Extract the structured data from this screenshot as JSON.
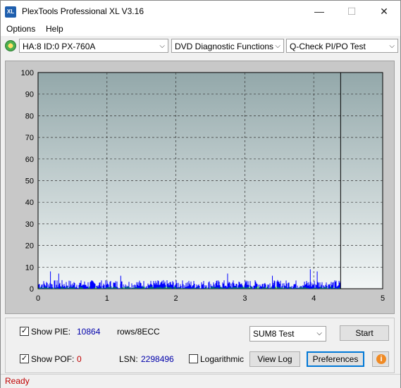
{
  "window": {
    "title": "PlexTools Professional XL V3.16",
    "icon_label": "XL"
  },
  "controls_window": {
    "minimize": "—",
    "maximize": "☐",
    "close": "✕"
  },
  "menu": {
    "items": [
      {
        "label": "Options"
      },
      {
        "label": "Help"
      }
    ]
  },
  "toolbar": {
    "drive": "HA:8 ID:0  PX-760A",
    "function": "DVD Diagnostic Functions",
    "test": "Q-Check PI/PO Test"
  },
  "chart_data": {
    "type": "bar",
    "title": "",
    "xlabel": "",
    "ylabel": "",
    "xlim": [
      0,
      5
    ],
    "ylim": [
      0,
      100
    ],
    "x_ticks": [
      "0",
      "1",
      "2",
      "3",
      "4",
      "5"
    ],
    "y_ticks": [
      "0",
      "10",
      "20",
      "30",
      "40",
      "50",
      "60",
      "70",
      "80",
      "90",
      "100"
    ],
    "grid": true,
    "marker_x": 4.39,
    "background_gradient": [
      "#93a8aa",
      "#f2f6f6"
    ],
    "series": [
      {
        "color": "#0000ff",
        "typical_max": 4,
        "peaks": [
          [
            0.18,
            8
          ],
          [
            0.3,
            7
          ],
          [
            1.2,
            6
          ],
          [
            2.75,
            7
          ],
          [
            3.4,
            6
          ],
          [
            3.95,
            9
          ],
          [
            4.05,
            8
          ]
        ]
      },
      {
        "color": "#00c000",
        "typical_max": 1
      }
    ]
  },
  "bottom": {
    "show_pie_label": "Show PIE:",
    "show_pie_value": "10864",
    "rows_label": "rows/8ECC",
    "show_pof_label": "Show POF:",
    "show_pof_value": "0",
    "lsn_label": "LSN:",
    "lsn_value": "2298496",
    "log_label": "Logarithmic",
    "test_select": "SUM8 Test",
    "start": "Start",
    "view_log": "View Log",
    "preferences": "Preferences",
    "info_icon": "i",
    "show_pie_checked": "✓",
    "show_pof_checked": "✓"
  },
  "colors": {
    "pie_value": "#0000aa",
    "pof_value": "#c00000",
    "status": "#c00000"
  },
  "status": {
    "text": "Ready"
  }
}
